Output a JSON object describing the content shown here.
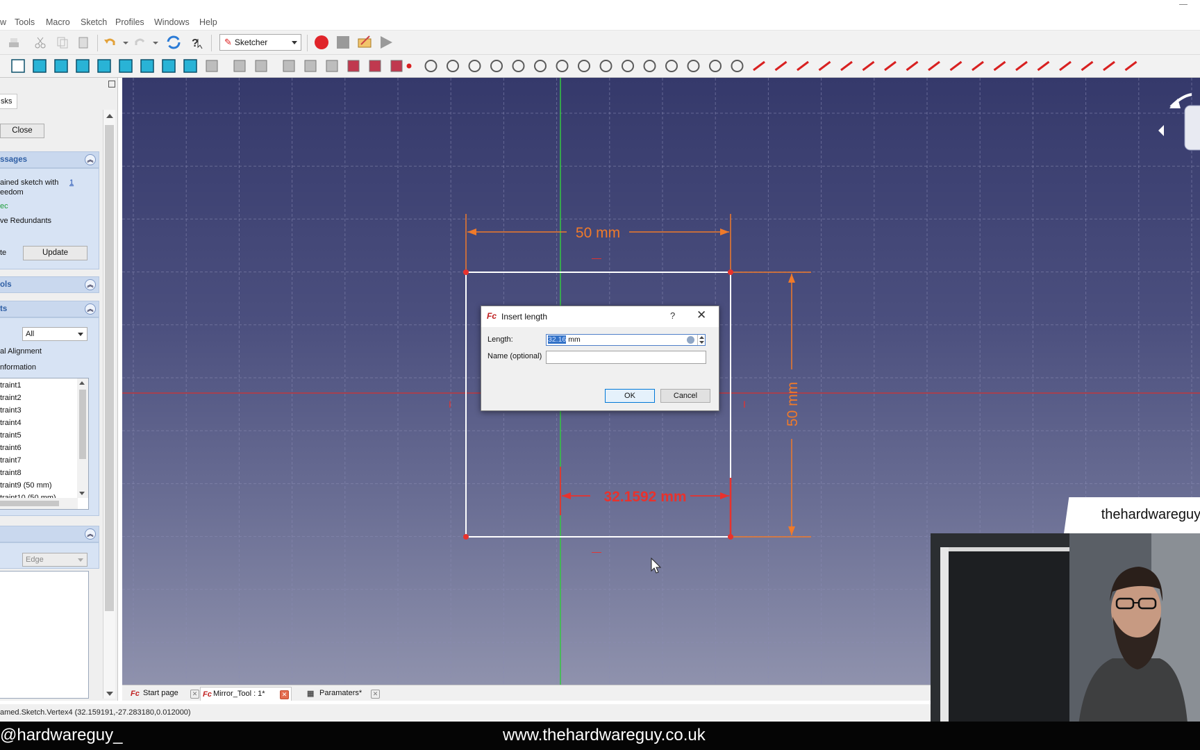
{
  "menubar": {
    "items": [
      "w",
      "Tools",
      "Macro",
      "Sketch",
      "Profiles",
      "Windows",
      "Help"
    ]
  },
  "toolbar": {
    "workbench": "Sketcher",
    "icons1": [
      "new-icon",
      "open-icon",
      "cut-icon",
      "copy-icon",
      "paste-icon",
      "undo-icon",
      "redo-icon",
      "refresh-icon",
      "whats-this-icon",
      "macro-record-icon",
      "macro-stop-icon",
      "macro-edit-icon",
      "macro-run-icon"
    ],
    "icons2": [
      "draw-style-icon",
      "view-fit-icon",
      "view-iso-icon",
      "view-front-icon",
      "view-top-icon",
      "view-right-icon",
      "view-rear-icon",
      "view-bottom-icon",
      "view-left-icon",
      "measure-icon",
      "part-icon",
      "group-icon",
      "new-sketch-icon",
      "leave-sketch-icon",
      "view-sketch-icon",
      "view-section-icon",
      "map-sketch-icon",
      "reorient-sketch-icon",
      "point-icon",
      "line-icon",
      "arc-icon",
      "circle-icon",
      "conic-icon",
      "bspline-icon",
      "polyline-icon",
      "rectangle-icon",
      "polygon-icon",
      "slot-icon",
      "fillet-icon",
      "trim-icon",
      "extend-icon",
      "external-geometry-icon",
      "carbon-copy-icon",
      "construction-mode-icon",
      "constrain-coincident-icon",
      "constrain-point-on-object-icon",
      "constrain-vertical-icon",
      "constrain-horizontal-icon",
      "constrain-parallel-icon",
      "constrain-perpendicular-icon",
      "constrain-tangent-icon",
      "constrain-equal-icon",
      "constrain-symmetric-icon",
      "constrain-block-icon",
      "constrain-lock-icon",
      "constrain-horizontal-distance-icon",
      "constrain-vertical-distance-icon",
      "constrain-distance-icon",
      "constrain-radius-icon",
      "more-icon",
      "select-constraints-icon",
      "more2-icon"
    ]
  },
  "panel": {
    "tab": "sks",
    "close": "Close",
    "messages": {
      "title": "ssages",
      "line1": "ained sketch with",
      "link": "1",
      "line2": "eedom",
      "status": "ec",
      "remove_redundants": "ve Redundants",
      "auto": "te",
      "update": "Update"
    },
    "tools": {
      "title": "ols"
    },
    "constraints": {
      "title": "ts",
      "filter": "All",
      "option1": "al Alignment",
      "option2": "nformation",
      "items": [
        "traint1",
        "traint2",
        "traint3",
        "traint4",
        "traint5",
        "traint6",
        "traint7",
        "traint8",
        "traint9 (50 mm)",
        "traint10 (50 mm)"
      ]
    },
    "elements": {
      "type": "Edge"
    }
  },
  "sketch": {
    "dim_top": "50 mm",
    "dim_right": "50 mm",
    "dim_inner": "32.1592 mm",
    "constraint_marks": [
      "—",
      "I",
      "I",
      "—"
    ]
  },
  "dialog": {
    "title": "Insert length",
    "help": "?",
    "close": "✕",
    "length_label": "Length:",
    "length_selected": "32.16",
    "length_unit": " mm",
    "name_label": "Name (optional)",
    "name_value": "",
    "ok": "OK",
    "cancel": "Cancel"
  },
  "tabs": [
    {
      "label": "Start page",
      "active": false
    },
    {
      "label": "Mirror_Tool : 1*",
      "active": true
    },
    {
      "label": "Paramaters*",
      "active": false
    }
  ],
  "status": "amed.Sketch.Vertex4 (32.159191,-27.283180,0.012000)",
  "overlay": {
    "handle": "@hardwareguy_",
    "website": "www.thehardwareguy.co.uk",
    "name": "thehardwareguy"
  },
  "colors": {
    "constraint_orange": "#f07a2a",
    "constraint_red": "#e8322d",
    "axis_green": "#34c740",
    "axis_red": "#d43030",
    "edge_white": "#ffffff"
  }
}
